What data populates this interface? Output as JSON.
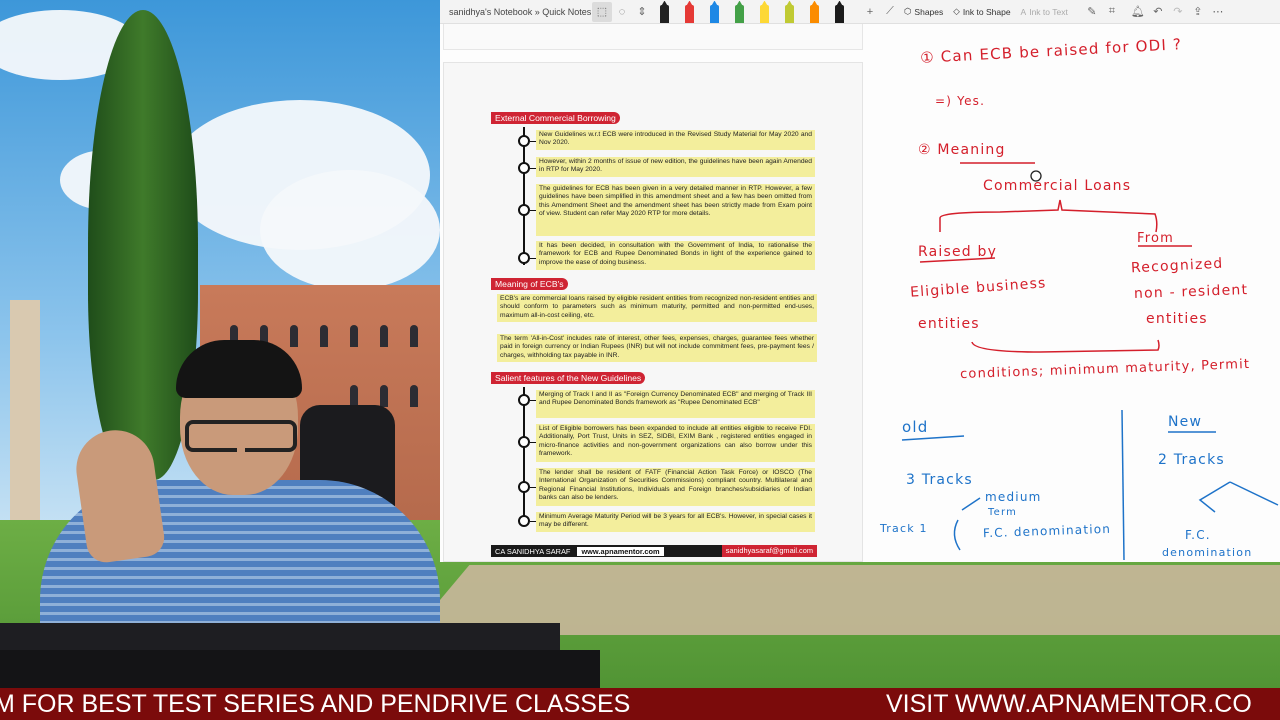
{
  "app": {
    "breadcrumb": "sanidhya's Notebook » Quick Notes",
    "tools": {
      "shapes": "Shapes",
      "ink_to_shape": "Ink to Shape",
      "ink_to_text": "Ink to Text"
    },
    "pen_colors": [
      "#222222",
      "#e53935",
      "#1e88e5",
      "#43a047",
      "#fdd835",
      "#c0ca33",
      "#fb8c00",
      "#1b1b1b"
    ],
    "pen_icons": [
      "pen-black-icon",
      "pen-red-icon",
      "pen-blue-icon",
      "pen-green-icon",
      "highlighter-yellow-icon",
      "highlighter-lime-icon",
      "pen-orange-icon",
      "pen-dark-icon"
    ]
  },
  "document": {
    "sections": [
      {
        "heading": "External Commercial Borrowing",
        "items": [
          "New Guidelines w.r.t ECB were introduced in the Revised Study Material for May 2020 and Nov 2020.",
          "However, within 2 months of issue of new edition, the guidelines have been again Amended in RTP for May 2020.",
          "The guidelines for ECB has been given in a very detailed manner in RTP. However, a few guidelines have been simplified in this amendment sheet and a few has been omitted from this Amendment Sheet and the amendment sheet has been strictly made from Exam point of view. Student can refer May 2020 RTP for more details.",
          "It has been decided, in consultation with the Government of India, to rationalise the framework for ECB and Rupee Denominated Bonds in light of the experience gained to improve the ease of doing business."
        ]
      },
      {
        "heading": "Meaning of ECB's",
        "paragraphs": [
          "ECB's are commercial loans raised by eligible resident entities from recognized non-resident entities and should conform to parameters such as minimum maturity, permitted and non-permitted end-uses, maximum all-in-cost ceiling, etc.",
          "The term 'All-in-Cost' includes rate of interest, other fees, expenses, charges, guarantee fees whether paid in foreign currency or Indian Rupees (INR) but will not include commitment fees, pre-payment fees / charges, withholding tax payable in INR."
        ]
      },
      {
        "heading": "Salient features of the New Guidelines",
        "items": [
          "Merging of Track I and II as \"Foreign Currency Denominated ECB\" and merging of Track III and Rupee Denominated Bonds framework as \"Rupee Denominated ECB\"",
          "List of Eligible borrowers has been expanded to include all entities eligible to receive FDI. Additionally, Port Trust, Units in SEZ, SIDBI, EXIM Bank , registered entities engaged in micro-finance activities and non-government organizations can also borrow under this framework.",
          "The lender shall be resident of FATF (Financial Action Task Force) or IOSCO (The International Organization of Securities Commissions) compliant country. Multilateral and Regional Financial Institutions, Individuals and Foreign branches/subsidiaries of Indian banks can also be lenders.",
          "Minimum Average Maturity Period will be 3 years for all ECB's. However, in special cases it may be different."
        ]
      }
    ],
    "footer": {
      "name": "CA SANIDHYA SARAF",
      "website": "www.apnamentor.com",
      "email": "sanidhyasaraf@gmail.com"
    }
  },
  "handwriting": {
    "q1": "① Can ECB be raised for ODI ?",
    "a1": "=) Yes.",
    "q2": "② Meaning",
    "commercial_loans": "Commercial Loans",
    "raised_by": "Raised by",
    "eligible_1": "Eligible business",
    "eligible_2": "entities",
    "from": "From",
    "recognized_1": "Recognized",
    "recognized_2": "non - resident",
    "recognized_3": "entities",
    "conditions": "conditions; minimum maturity, Permit",
    "old": "old",
    "new": "New",
    "three_tracks": "3 Tracks",
    "medium_1": "medium",
    "medium_2": "Term",
    "track1": "Track 1",
    "fc_denom": "F.C. denomination",
    "two_tracks": "2 Tracks",
    "fc_short": "F.C.",
    "fc_short_2": "denomination"
  },
  "ticker": {
    "left": "M FOR BEST TEST SERIES AND PENDRIVE CLASSES",
    "right": "VISIT WWW.APNAMENTOR.CO"
  }
}
